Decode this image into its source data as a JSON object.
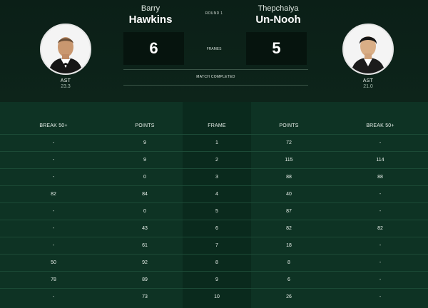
{
  "match": {
    "round": "ROUND 1",
    "frames_label": "FRAMES",
    "status": "MATCH COMPLETED"
  },
  "player_left": {
    "first_name": "Barry",
    "last_name": "Hawkins",
    "score": "6",
    "country": "AST",
    "average": "23.3"
  },
  "player_right": {
    "first_name": "Thepchaiya",
    "last_name": "Un-Nooh",
    "score": "5",
    "country": "AST",
    "average": "21.0"
  },
  "table": {
    "headers": [
      "BREAK 50+",
      "POINTS",
      "FRAME",
      "POINTS",
      "BREAK 50+"
    ],
    "rows": [
      [
        "-",
        "9",
        "1",
        "72",
        "-"
      ],
      [
        "-",
        "9",
        "2",
        "115",
        "114"
      ],
      [
        "-",
        "0",
        "3",
        "88",
        "88"
      ],
      [
        "82",
        "84",
        "4",
        "40",
        "-"
      ],
      [
        "-",
        "0",
        "5",
        "87",
        "-"
      ],
      [
        "-",
        "43",
        "6",
        "82",
        "82"
      ],
      [
        "-",
        "61",
        "7",
        "18",
        "-"
      ],
      [
        "50",
        "92",
        "8",
        "8",
        "-"
      ],
      [
        "78",
        "89",
        "9",
        "6",
        "-"
      ],
      [
        "-",
        "73",
        "10",
        "26",
        "-"
      ]
    ]
  }
}
